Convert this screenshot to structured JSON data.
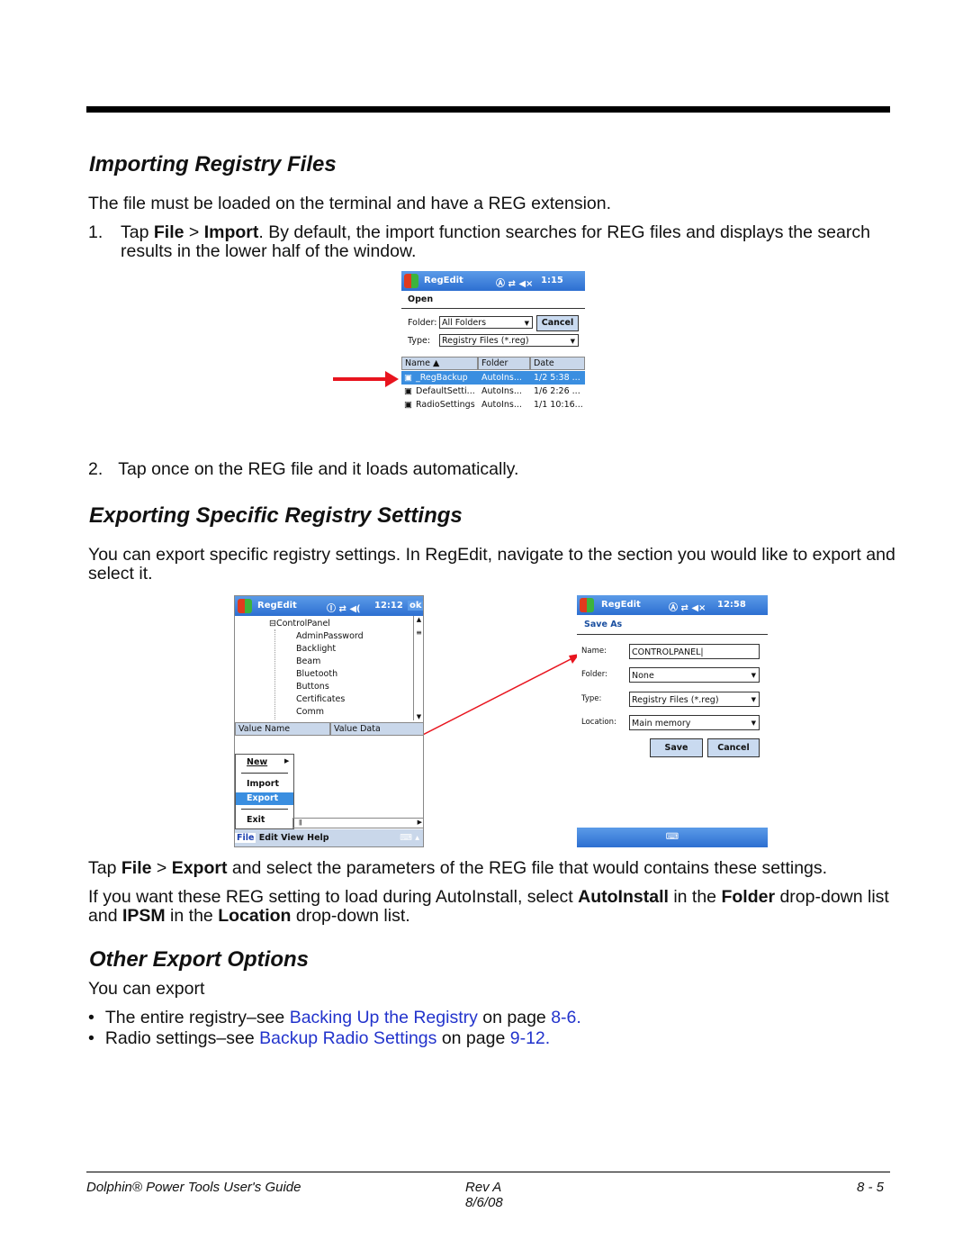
{
  "sections": {
    "import_title": "Importing Registry Files",
    "import_intro": "The file must be loaded on the terminal and have a REG extension.",
    "step1": {
      "num": "1.",
      "pre": "Tap ",
      "file": "File",
      "sep": " > ",
      "import": "Import",
      "post": ". By default, the import function searches for REG files and displays the search results in the lower half of the window."
    },
    "step2": {
      "num": "2.",
      "text": "Tap once on the REG file and it loads automatically."
    },
    "export_title": "Exporting Specific Registry Settings",
    "export_intro": "You can export specific registry settings. In RegEdit, navigate to the section you would like to export and select it.",
    "tap_export": {
      "pre": "Tap ",
      "file": "File",
      "sep": " > ",
      "export": "Export",
      "post": " and select the parameters of the REG file that would contains these settings."
    },
    "autoinstall": {
      "a": "If you want these REG setting to load during AutoInstall, select ",
      "b": "AutoInstall",
      "c": " in the ",
      "d": "Folder",
      "e": " drop-down list and ",
      "f": "IPSM",
      "g": " in the ",
      "h": "Location",
      "i": " drop-down list."
    },
    "other_title": "Other Export Options",
    "other_intro": "You can export",
    "bullets": [
      {
        "pre": "The entire registry–see ",
        "link": "Backing Up the Registry",
        "mid": " on page ",
        "page": "8-6."
      },
      {
        "pre": "Radio settings–see ",
        "link": "Backup Radio Settings",
        "mid": " on page ",
        "page": "9-12."
      }
    ]
  },
  "shot_open": {
    "app": "RegEdit",
    "time": "1:15",
    "heading": "Open",
    "folder_label": "Folder:",
    "folder_value": "All Folders",
    "cancel": "Cancel",
    "type_label": "Type:",
    "type_value": "Registry Files (*.reg)",
    "columns": [
      "Name",
      "Folder",
      "Date"
    ],
    "rows": [
      [
        "_RegBackup",
        "AutoIns...",
        "1/2 5:38 ..."
      ],
      [
        "DefaultSetti...",
        "AutoIns...",
        "1/6 2:26 ..."
      ],
      [
        "RadioSettings",
        "AutoIns...",
        "1/1 10:16..."
      ]
    ]
  },
  "shot_tree": {
    "app": "RegEdit",
    "time": "12:12",
    "ok": "ok",
    "root": "ControlPanel",
    "children": [
      "AdminPassword",
      "Backlight",
      "Beam",
      "Bluetooth",
      "Buttons",
      "Certificates",
      "Comm"
    ],
    "columns": [
      "Value Name",
      "Value Data"
    ],
    "menu": [
      "New",
      "Import",
      "Export",
      "Exit"
    ],
    "menubar": [
      "File",
      "Edit",
      "View",
      "Help"
    ]
  },
  "shot_save": {
    "app": "RegEdit",
    "time": "12:58",
    "heading": "Save As",
    "name_label": "Name:",
    "name_value": "CONTROLPANEL",
    "folder_label": "Folder:",
    "folder_value": "None",
    "type_label": "Type:",
    "type_value": "Registry Files (*.reg)",
    "location_label": "Location:",
    "location_value": "Main memory",
    "save": "Save",
    "cancel": "Cancel"
  },
  "footer": {
    "left": "Dolphin® Power Tools User's Guide",
    "rev": "Rev A",
    "date": "8/6/08",
    "page": "8 - 5"
  },
  "colors": {
    "link": "#2233cc",
    "arrow": "#e8141e",
    "titlebar": "#2d6fd1"
  }
}
